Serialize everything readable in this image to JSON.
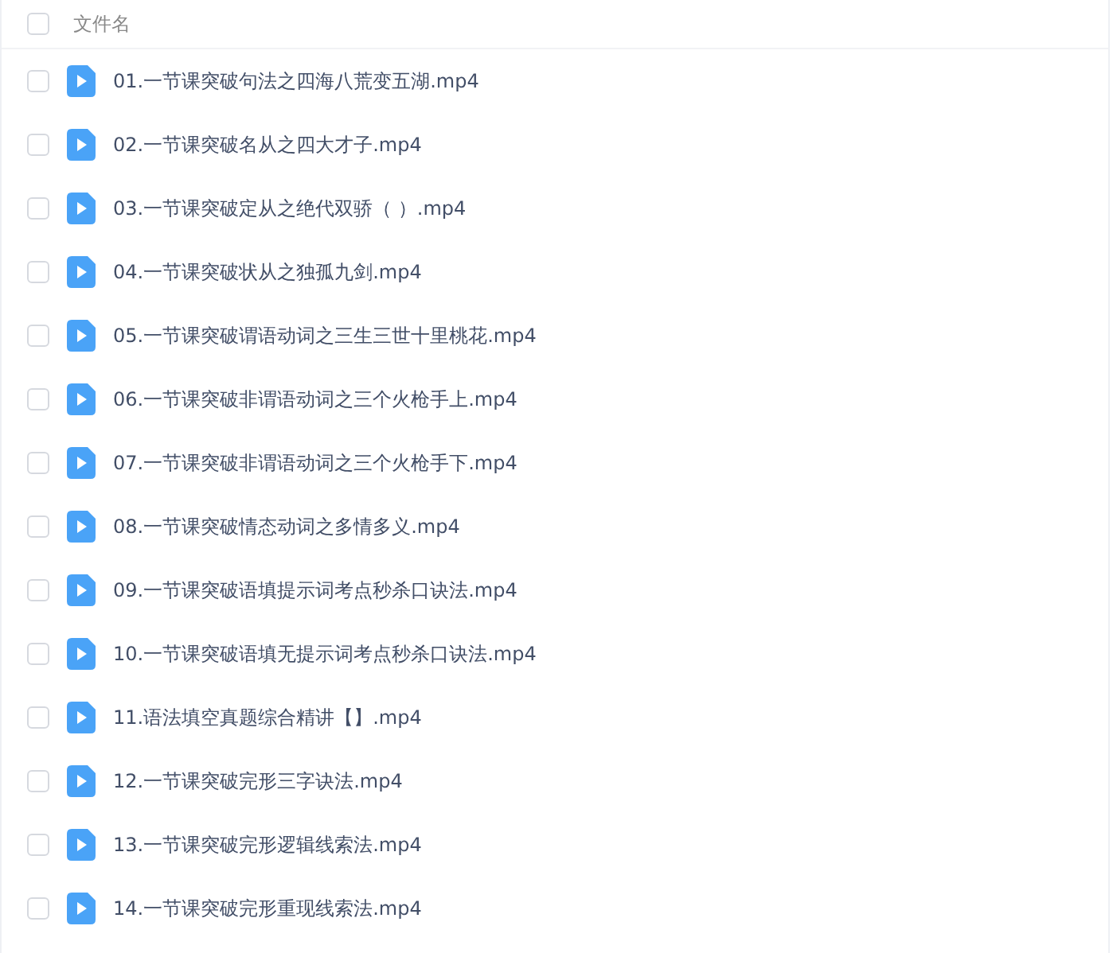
{
  "header": {
    "checked": false,
    "label": "文件名"
  },
  "files": [
    {
      "name": "01.一节课突破句法之四海八荒变五湖.mp4",
      "checked": false
    },
    {
      "name": "02.一节课突破名从之四大才子.mp4",
      "checked": false
    },
    {
      "name": "03.一节课突破定从之绝代双骄（  ）.mp4",
      "checked": false
    },
    {
      "name": "04.一节课突破状从之独孤九剑.mp4",
      "checked": false
    },
    {
      "name": "05.一节课突破谓语动词之三生三世十里桃花.mp4",
      "checked": false
    },
    {
      "name": "06.一节课突破非谓语动词之三个火枪手上.mp4",
      "checked": false
    },
    {
      "name": "07.一节课突破非谓语动词之三个火枪手下.mp4",
      "checked": false
    },
    {
      "name": "08.一节课突破情态动词之多情多义.mp4",
      "checked": false
    },
    {
      "name": "09.一节课突破语填提示词考点秒杀口诀法.mp4",
      "checked": false
    },
    {
      "name": "10.一节课突破语填无提示词考点秒杀口诀法.mp4",
      "checked": false
    },
    {
      "name": "11.语法填空真题综合精讲【】.mp4",
      "checked": false
    },
    {
      "name": "12.一节课突破完形三字诀法.mp4",
      "checked": false
    },
    {
      "name": "13.一节课突破完形逻辑线索法.mp4",
      "checked": false
    },
    {
      "name": "14.一节课突破完形重现线索法.mp4",
      "checked": false
    }
  ]
}
